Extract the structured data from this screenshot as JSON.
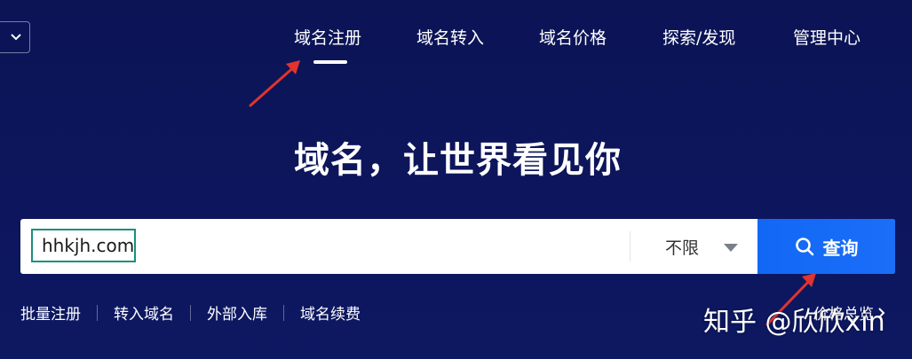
{
  "nav": {
    "items": [
      {
        "label": "域名注册",
        "active": true
      },
      {
        "label": "域名转入"
      },
      {
        "label": "域名价格"
      },
      {
        "label": "探索/发现"
      },
      {
        "label": "管理中心"
      }
    ]
  },
  "hero": {
    "title": "域名，让世界看见你"
  },
  "search": {
    "value": "hhkjh.com",
    "select_label": "不限",
    "button_label": "查询"
  },
  "quick_links": [
    "批量注册",
    "转入域名",
    "外部入库",
    "域名续费"
  ],
  "price_link": "价格总览",
  "watermark": "知乎 @欣欣xin",
  "colors": {
    "background": "#0d165c",
    "search_button": "#1268f5",
    "input_highlight": "#1b8f7f",
    "annotation_arrow": "#e0342f"
  }
}
